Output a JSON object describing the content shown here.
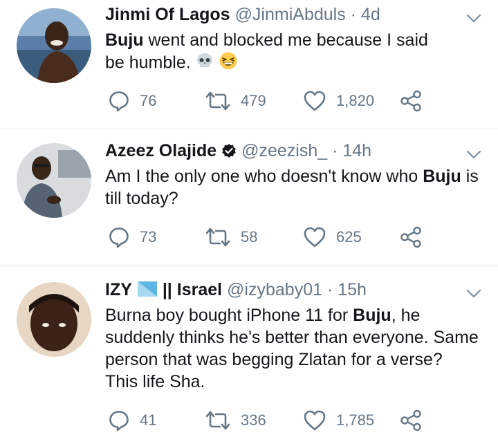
{
  "tweets": [
    {
      "name": "Jinmi Of Lagos",
      "handle": "@JinmiAbduls",
      "time": "· 4d",
      "text_parts": [
        "",
        "Buju",
        " went and blocked me because I said be humble."
      ],
      "emojis": [
        "skull-icon",
        "grinning-squinting-face-icon"
      ],
      "replies": "76",
      "retweets": "479",
      "likes": "1,820"
    },
    {
      "name": "Azeez Olajide",
      "handle": "@zeezish_",
      "time": "· 14h",
      "text_parts": [
        "Am I the only one who doesn't know who ",
        "Buju",
        " is till today?"
      ],
      "replies": "73",
      "retweets": "58",
      "likes": "625"
    },
    {
      "name_a": "IZY",
      "name_b": "|| Israel",
      "handle": "@izybaby01",
      "time": "· 15h",
      "text_parts": [
        "Burna boy bought iPhone 11 for ",
        "Buju",
        ", he suddenly thinks he's better than everyone. Same person that was begging Zlatan for a verse? This life Sha."
      ],
      "replies": "41",
      "retweets": "336",
      "likes": "1,785"
    }
  ],
  "colors": {
    "text": "#14171a",
    "muted": "#657786",
    "divider": "#e1e8ed",
    "verified": "#14171a"
  }
}
